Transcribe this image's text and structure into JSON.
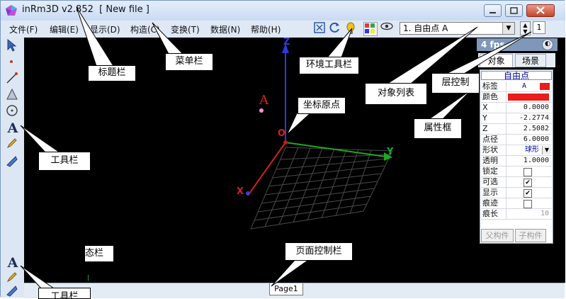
{
  "window": {
    "title": "inRm3D v2.852  [ New file ]"
  },
  "menu": [
    "文件(F)",
    "编辑(E)",
    "显示(D)",
    "构造(C)",
    "变换(T)",
    "数据(N)",
    "帮助(H)"
  ],
  "object_list": {
    "selected": "1. 自由点 A"
  },
  "layer_control": {
    "value": "1"
  },
  "panel": {
    "fps": "4 fps",
    "tabs": [
      "对象",
      "场景"
    ],
    "active_tab": "对象",
    "title": "自由点",
    "rows": [
      {
        "key": "标签",
        "value": "A",
        "swatch": "#ec1c1c"
      },
      {
        "key": "颜色",
        "value": "",
        "color": "#ec1c1c"
      },
      {
        "key": "X",
        "value": "0.0000"
      },
      {
        "key": "Y",
        "value": "-2.2774"
      },
      {
        "key": "Z",
        "value": "2.5082"
      },
      {
        "key": "点径",
        "value": "6.0000"
      },
      {
        "key": "形状",
        "value": "球形"
      },
      {
        "key": "透明",
        "value": "1.0000"
      },
      {
        "key": "锁定",
        "checked": false
      },
      {
        "key": "可选",
        "checked": true
      },
      {
        "key": "显示",
        "checked": true
      },
      {
        "key": "痕迹",
        "checked": false
      },
      {
        "key": "痕长",
        "value": "10"
      }
    ],
    "buttons": [
      "父构件",
      "子构件"
    ]
  },
  "scene": {
    "point_label": "A",
    "origin_label": "O",
    "axis_x": "X",
    "axis_y": "Y",
    "axis_z": "Z"
  },
  "page_tab": "Page1",
  "callouts": {
    "title_bar": "标题栏",
    "menu_bar": "菜单栏",
    "env_toolbar": "环境工具栏",
    "object_list": "对象列表",
    "layer_control": "层控制",
    "origin": "坐标原点",
    "property_box": "属性框",
    "toolbar": "工具栏",
    "page_control": "页面控制栏",
    "status_bar_fragment": "态栏",
    "toolbar_bottom": "工具栏"
  }
}
